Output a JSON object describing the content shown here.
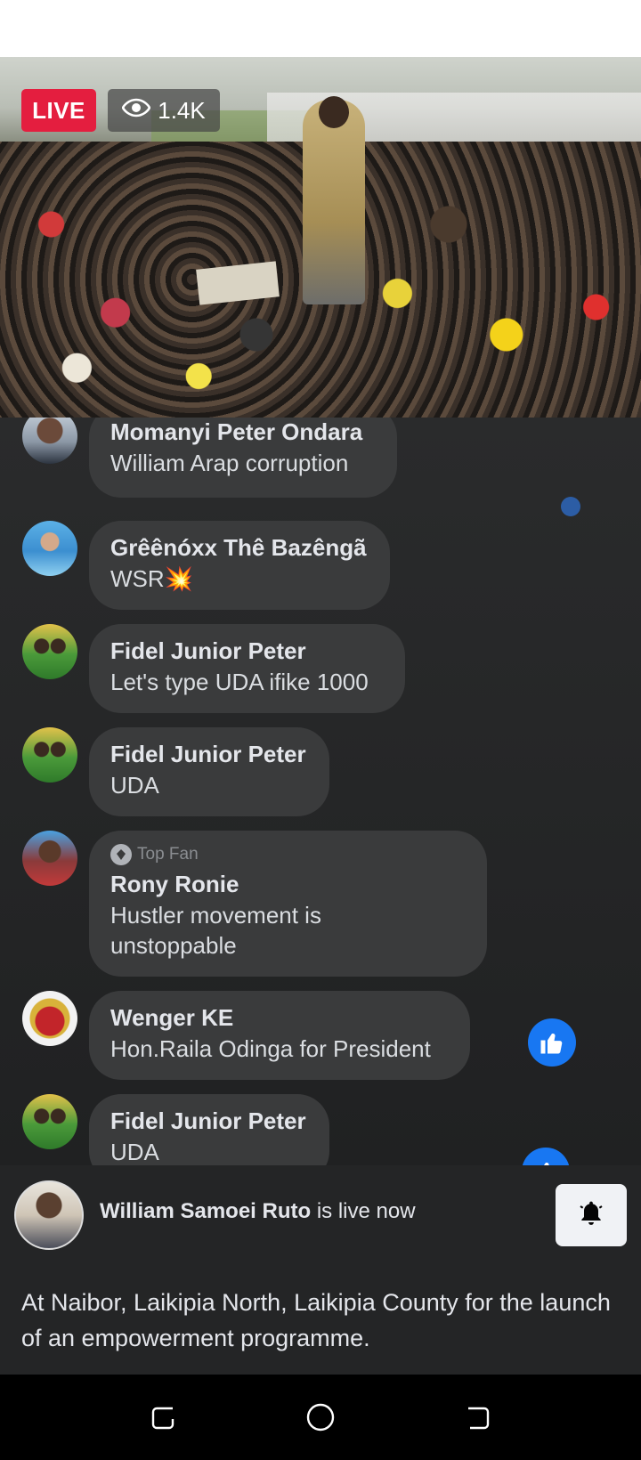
{
  "video": {
    "live_label": "LIVE",
    "viewers": "1.4K"
  },
  "comments": [
    {
      "name": "Momanyi Peter Ondara",
      "text": "William Arap corruption"
    },
    {
      "name": "Grêênóxx Thê Bazêngã",
      "text": "WSR💥"
    },
    {
      "name": "Fidel Junior Peter",
      "text": "Let's type UDA ifike 1000"
    },
    {
      "name": "Fidel Junior Peter",
      "text": "UDA"
    },
    {
      "badge": "Top Fan",
      "name": "Rony Ronie",
      "text": "Hustler movement is unstoppable"
    },
    {
      "name": "Wenger KE",
      "text": "Hon.Raila Odinga for President"
    },
    {
      "name": "Fidel Junior Peter",
      "text": "UDA"
    }
  ],
  "now_live": {
    "host_name": "William Samoei Ruto",
    "status_text": "is live now",
    "description": "At Naibor, Laikipia North, Laikipia County for the launch of an empowerment programme."
  },
  "colors": {
    "live_red": "#e41e3f",
    "like_blue": "#1877f2",
    "bubble": "#3a3b3c",
    "background": "#242526"
  },
  "icons": [
    "eye-icon",
    "top-fan-icon",
    "like-icon",
    "bell-icon",
    "recent-apps-icon",
    "home-icon",
    "back-icon"
  ]
}
